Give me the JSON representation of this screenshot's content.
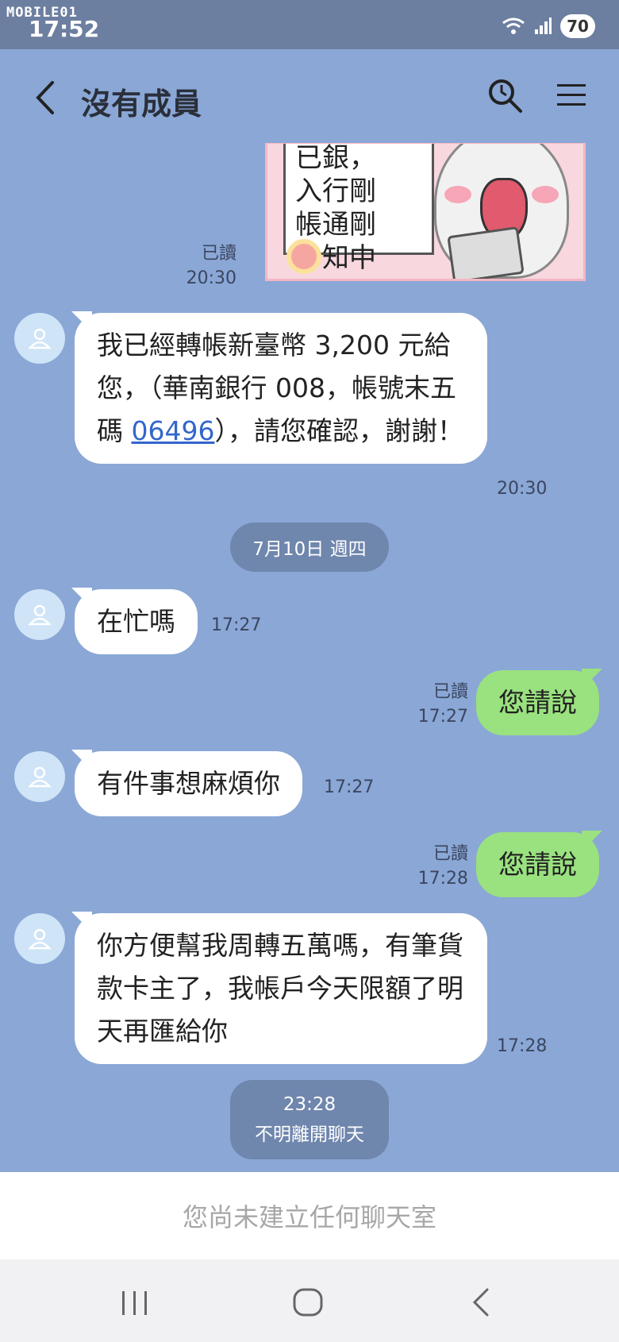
{
  "status_bar": {
    "watermark": "MOBILE01",
    "time": "17:52",
    "battery": "70"
  },
  "header": {
    "title": "沒有成員",
    "back_icon": "chevron-left-icon",
    "search_icon": "search-icon",
    "menu_icon": "menu-icon"
  },
  "sticker": {
    "lines": [
      "已銀，",
      "入行剛",
      "帳通剛",
      "知中"
    ]
  },
  "messages": [
    {
      "read": "已讀",
      "time": "20:30"
    },
    {
      "text_before": "我已經轉帳新臺幣 3,200 元給您，（華南銀行 008，帳號末五碼 ",
      "link": "06496",
      "text_after": "），請您確認，謝謝！",
      "time": "20:30"
    },
    {
      "text": "在忙嗎",
      "time": "17:27"
    },
    {
      "text": "您請說",
      "read": "已讀",
      "time": "17:27"
    },
    {
      "text": "有件事想麻煩你",
      "time": "17:27"
    },
    {
      "text": "您請說",
      "read": "已讀",
      "time": "17:28"
    },
    {
      "text": "你方便幫我周轉五萬嗎，有筆貨款卡主了，我帳戶今天限額了明天再匯給你",
      "time": "17:28"
    }
  ],
  "date_chip": "7月10日 週四",
  "system": {
    "time": "23:28",
    "text": "不明離開聊天"
  },
  "footer": {
    "notice": "您尚未建立任何聊天室"
  },
  "colors": {
    "chat_bg": "#8aa7d6",
    "sent_bubble": "#9ae17f",
    "received_bubble": "#ffffff",
    "status_bar": "#6d7fa0"
  }
}
